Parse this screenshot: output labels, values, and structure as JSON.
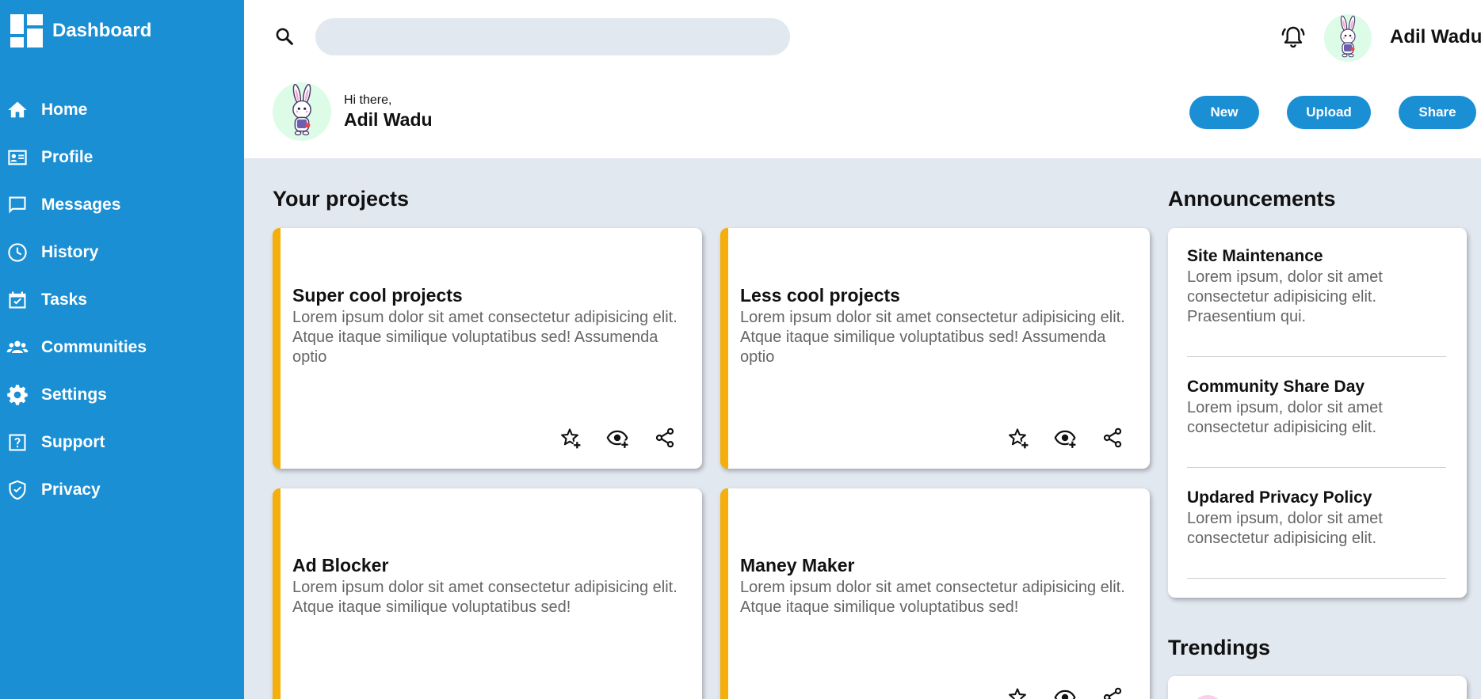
{
  "sidebar": {
    "title": "Dashboard",
    "items": [
      {
        "label": "Home",
        "icon": "home-icon"
      },
      {
        "label": "Profile",
        "icon": "id-card-icon"
      },
      {
        "label": "Messages",
        "icon": "message-icon"
      },
      {
        "label": "History",
        "icon": "clock-icon"
      },
      {
        "label": "Tasks",
        "icon": "calendar-check-icon"
      },
      {
        "label": "Communities",
        "icon": "people-icon"
      },
      {
        "label": "Settings",
        "icon": "gear-icon"
      },
      {
        "label": "Support",
        "icon": "help-icon"
      },
      {
        "label": "Privacy",
        "icon": "shield-icon"
      }
    ]
  },
  "header": {
    "search": {
      "value": "",
      "placeholder": ""
    },
    "user_name": "Adil Wadu",
    "greeting": "Hi there,",
    "greeting_name": "Adil Wadu",
    "buttons": {
      "new": "New",
      "upload": "Upload",
      "share": "Share"
    }
  },
  "projects": {
    "heading": "Your projects",
    "cards": [
      {
        "title": "Super cool projects",
        "description": "Lorem ipsum dolor sit amet consectetur adipisicing elit. Atque itaque similique voluptatibus sed! Assumenda optio"
      },
      {
        "title": "Less cool projects",
        "description": "Lorem ipsum dolor sit amet consectetur adipisicing elit. Atque itaque similique voluptatibus sed! Assumenda optio"
      },
      {
        "title": "Ad Blocker",
        "description": "Lorem ipsum dolor sit amet consectetur adipisicing elit. Atque itaque similique voluptatibus sed!"
      },
      {
        "title": "Maney Maker",
        "description": "Lorem ipsum dolor sit amet consectetur adipisicing elit. Atque itaque similique voluptatibus sed!"
      }
    ]
  },
  "announcements": {
    "heading": "Announcements",
    "items": [
      {
        "title": "Site Maintenance",
        "text": "Lorem ipsum, dolor sit amet consectetur adipisicing elit. Praesentium qui."
      },
      {
        "title": "Community Share Day",
        "text": "Lorem ipsum, dolor sit amet consectetur adipisicing elit."
      },
      {
        "title": "Updared Privacy Policy",
        "text": "Lorem ipsum, dolor sit amet consectetur adipisicing elit."
      }
    ]
  },
  "trendings": {
    "heading": "Trendings"
  },
  "colors": {
    "primary": "#1a8fd4",
    "accent": "#f6ae0b",
    "background": "#e2e8f0",
    "avatar_bg": "#dcfce7"
  }
}
